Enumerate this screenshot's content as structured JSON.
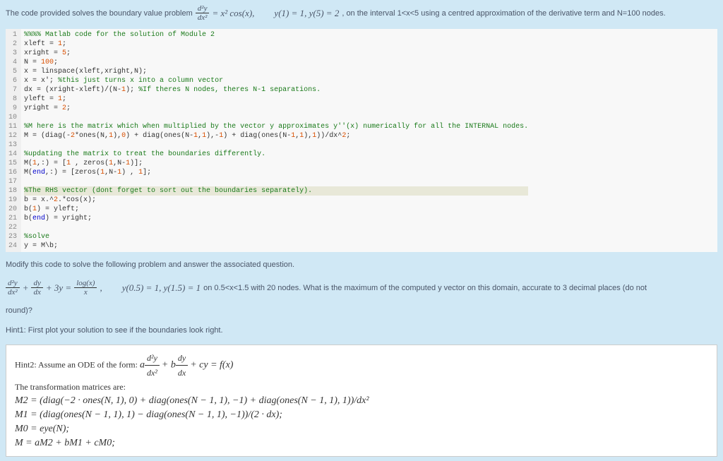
{
  "problem": {
    "intro": "The code provided solves the boundary value problem",
    "eq_lhs_num": "d²y",
    "eq_lhs_den": "dx²",
    "eq_rhs": "= x² cos(x),",
    "bc": "y(1) = 1,  y(5) = 2",
    "tail": ", on the interval 1<x<5 using a centred approximation of the derivative term and N=100 nodes."
  },
  "code": {
    "line_numbers": "1\n2\n3\n4\n5\n6\n7\n8\n9\n10\n11\n12\n13\n14\n15\n16\n17\n18\n19\n20\n21\n22\n23\n24",
    "l1": "%%%% Matlab code for the solution of Module 2",
    "l2a": "xleft = ",
    "l2b": "1",
    "l2c": ";",
    "l3a": "xright = ",
    "l3b": "5",
    "l3c": ";",
    "l4a": "N = ",
    "l4b": "100",
    "l4c": ";",
    "l5a": "x = linspace(xleft,xright,N);",
    "l6a": "x = x'; ",
    "l6b": "%this just turns x into a column vector",
    "l7a": "dx = (xright-xleft)/(N-",
    "l7b": "1",
    "l7c": "); ",
    "l7d": "%If theres N nodes, theres N-1 separations.",
    "l8a": "yleft = ",
    "l8b": "1",
    "l8c": ";",
    "l9a": "yright = ",
    "l9b": "2",
    "l9c": ";",
    "l11": "%M here is the matrix which when multiplied by the vector y approximates y''(x) numerically for all the INTERNAL nodes.",
    "l12a": "M = (diag(-",
    "l12b": "2",
    "l12c": "*ones(N,",
    "l12d": "1",
    "l12e": "),",
    "l12f": "0",
    "l12g": ") + diag(ones(N-",
    "l12h": "1",
    "l12i": ",",
    "l12j": "1",
    "l12k": "),-",
    "l12l": "1",
    "l12m": ") + diag(ones(N-",
    "l12n": "1",
    "l12o": ",",
    "l12p": "1",
    "l12q": "),",
    "l12r": "1",
    "l12s": "))/dx^",
    "l12t": "2",
    "l12u": ";",
    "l14": "%updating the matrix to treat the boundaries differently.",
    "l15a": "M(",
    "l15b": "1",
    "l15c": ",:) = [",
    "l15d": "1",
    "l15e": " , zeros(",
    "l15f": "1",
    "l15g": ",N-",
    "l15h": "1",
    "l15i": ")];",
    "l16a": "M(",
    "l16b": "end",
    "l16c": ",:) = [zeros(",
    "l16d": "1",
    "l16e": ",N-",
    "l16f": "1",
    "l16g": ") , ",
    "l16h": "1",
    "l16i": "];",
    "l18": "%The RHS vector (dont forget to sort out the boundaries separately).",
    "l19a": "b = x.^",
    "l19b": "2",
    "l19c": ".*cos(x);",
    "l20a": "b(",
    "l20b": "1",
    "l20c": ") = yleft;",
    "l21a": "b(",
    "l21b": "end",
    "l21c": ") = yright;",
    "l23": "%solve",
    "l24": "y = M\\b;"
  },
  "modify": {
    "text1": "Modify this code to solve the following problem and answer the associated question.",
    "eq_d2y_num": "d²y",
    "eq_d2y_den": "dx²",
    "eq_plus1": "+",
    "eq_dy_num": "dy",
    "eq_dy_den": "dx",
    "eq_plus2": "+ 3y =",
    "eq_rhs_num": "log(x)",
    "eq_rhs_den": "x",
    "eq_comma": ",",
    "bc": "y(0.5) = 1,  y(1.5) = 1",
    "tail": "on 0.5<x<1.5 with 20 nodes. What is the maximum of the computed y vector on this domain, accurate to 3 decimal places (do not",
    "round": "round)?",
    "hint1": "Hint1: First plot your solution to see if the boundaries look right."
  },
  "hint2": {
    "line1a": "Hint2: Assume an ODE of the form:   ",
    "line1_a": "a",
    "line1_d2y_num": "d²y",
    "line1_d2y_den": "dx²",
    "line1_plus1": "+ b",
    "line1_dy_num": "dy",
    "line1_dy_den": "dx",
    "line1_plus2": "+ cy = f(x)",
    "line2": "The transformation matrices are:",
    "line3": "M2 = (diag(−2 · ones(N, 1), 0) + diag(ones(N − 1, 1), −1) + diag(ones(N − 1, 1), 1))/dx²",
    "line4": "M1 = (diag(ones(N − 1, 1), 1) − diag(ones(N − 1, 1), −1))/(2 · dx);",
    "line5": "M0 = eye(N);",
    "line6": "M  = aM2 + bM1 + cM0;"
  }
}
